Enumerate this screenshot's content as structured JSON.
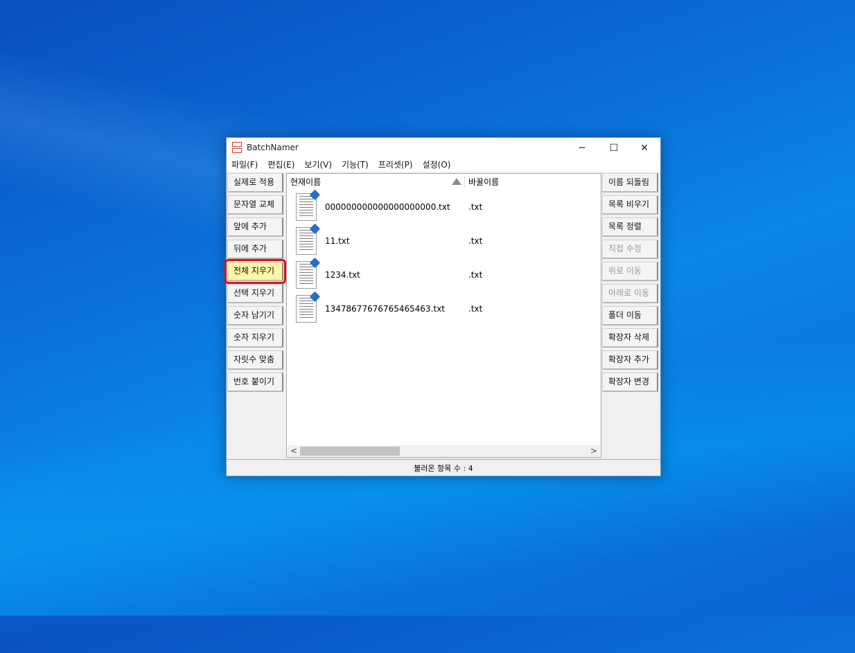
{
  "window": {
    "title": "BatchNamer",
    "icon": "batchnamer-app-icon"
  },
  "controls": {
    "minimize": "─",
    "maximize": "☐",
    "close": "✕"
  },
  "menu": [
    "파일(F)",
    "편집(E)",
    "보기(V)",
    "기능(T)",
    "프리셋(P)",
    "설정(O)"
  ],
  "left_buttons": [
    {
      "label": "실제로 적용",
      "enabled": true
    },
    {
      "label": "문자열 교체",
      "enabled": true
    },
    {
      "label": "앞에 추가",
      "enabled": true
    },
    {
      "label": "뒤에 추가",
      "enabled": true
    },
    {
      "label": "전체 지우기",
      "enabled": true,
      "highlighted": true
    },
    {
      "label": "선택 지우기",
      "enabled": true
    },
    {
      "label": "숫자 남기기",
      "enabled": true
    },
    {
      "label": "숫자 지우기",
      "enabled": true
    },
    {
      "label": "자릿수 맞춤",
      "enabled": true
    },
    {
      "label": "번호 붙이기",
      "enabled": true
    }
  ],
  "right_buttons": [
    {
      "label": "이름 되돌림",
      "enabled": true
    },
    {
      "label": "목록 비우기",
      "enabled": true
    },
    {
      "label": "목록 정렬",
      "enabled": true
    },
    {
      "label": "직접 수정",
      "enabled": false
    },
    {
      "label": "위로 이동",
      "enabled": false
    },
    {
      "label": "아래로 이동",
      "enabled": false
    },
    {
      "label": "폴더 이동",
      "enabled": true
    },
    {
      "label": "확장자 삭제",
      "enabled": true
    },
    {
      "label": "확장자 추가",
      "enabled": true
    },
    {
      "label": "확장자 변경",
      "enabled": true
    }
  ],
  "list": {
    "columns": {
      "current": "현재이름",
      "new": "바꿀이름"
    },
    "sort_icon": "sort-ascending-icon",
    "rows": [
      {
        "name": "000000000000000000000.txt",
        "new": ".txt"
      },
      {
        "name": "11.txt",
        "new": ".txt"
      },
      {
        "name": "1234.txt",
        "new": ".txt"
      },
      {
        "name": "13478677676765465463.txt",
        "new": ".txt"
      }
    ]
  },
  "scrollbar": {
    "left_arrow": "<",
    "right_arrow": ">"
  },
  "status": {
    "text": "불러온 항목 수 : 4"
  },
  "colors": {
    "highlight_border": "#e01010",
    "highlight_fill": "#fff6a8",
    "desktop": "#0b6fd8"
  }
}
